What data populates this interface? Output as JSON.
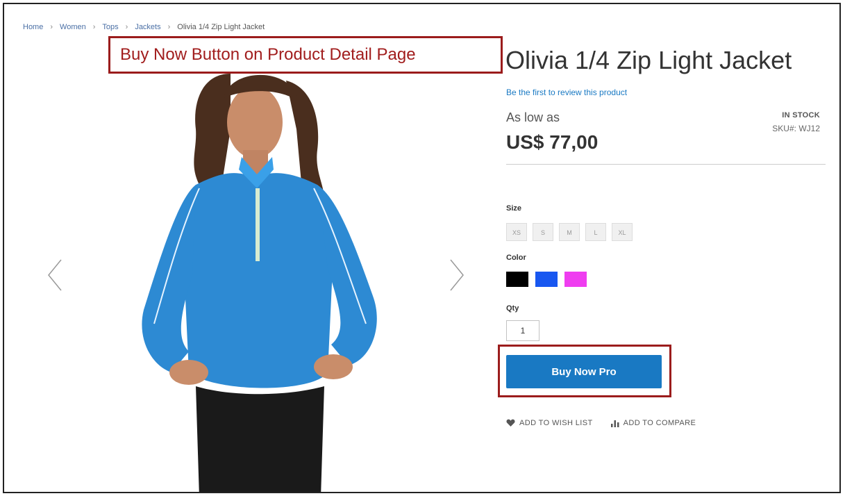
{
  "breadcrumb": {
    "items": [
      "Home",
      "Women",
      "Tops",
      "Jackets"
    ],
    "current": "Olivia 1/4 Zip Light Jacket"
  },
  "annotation": {
    "label": "Buy Now Button on Product Detail Page"
  },
  "product": {
    "title": "Olivia 1/4 Zip Light Jacket",
    "review_link": "Be the first to review this product",
    "price_prefix": "As low as",
    "price": "US$ 77,00",
    "stock": "IN STOCK",
    "sku": "SKU#:  WJ12"
  },
  "options": {
    "size_label": "Size",
    "sizes": [
      "XS",
      "S",
      "M",
      "L",
      "XL"
    ],
    "color_label": "Color",
    "colors": [
      "#000000",
      "#1857f0",
      "#ef3df0"
    ],
    "qty_label": "Qty",
    "qty_value": "1"
  },
  "buttons": {
    "buy_now": "Buy Now Pro",
    "wishlist": "ADD TO WISH LIST",
    "compare": "ADD TO COMPARE"
  },
  "icons": {
    "prev": "chevron-left-icon",
    "next": "chevron-right-icon",
    "wishlist": "heart-icon",
    "compare": "bar-chart-icon"
  }
}
